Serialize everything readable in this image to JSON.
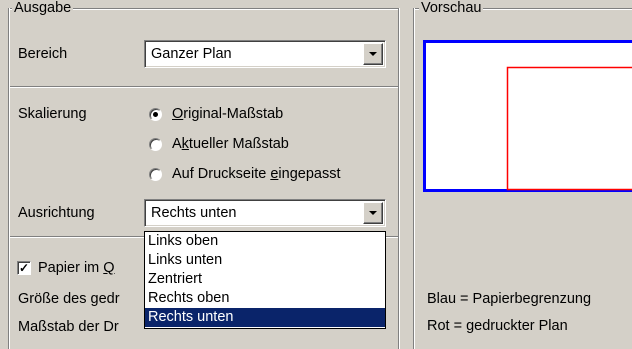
{
  "ausgabe": {
    "group_title": "Ausgabe",
    "bereich_label": "Bereich",
    "bereich_value": "Ganzer Plan",
    "skalierung_label": "Skalierung",
    "skalierung_options": [
      {
        "pre": "",
        "ul": "O",
        "post": "riginal-Maßstab",
        "selected": true
      },
      {
        "pre": "A",
        "ul": "k",
        "post": "tueller Maßstab",
        "selected": false
      },
      {
        "pre": "Auf Druckseite ",
        "ul": "e",
        "post": "ingepasst",
        "selected": false
      }
    ],
    "ausrichtung_label": "Ausrichtung",
    "ausrichtung_value": "Rechts unten",
    "ausrichtung_options": [
      "Links oben",
      "Links unten",
      "Zentriert",
      "Rechts oben",
      "Rechts unten"
    ],
    "ausrichtung_selected_index": 4,
    "papier_checkbox_pre": "Papier im ",
    "papier_checkbox_ul": "Q",
    "papier_checked": true,
    "groesse_label": "Größe des gedr",
    "massstab_label": "Maßstab der Dr"
  },
  "vorschau": {
    "group_title": "Vorschau",
    "legend_blue": "Blau = Papierbegrenzung",
    "legend_red": "Rot = gedruckter Plan",
    "colors": {
      "paper": "#0000ff",
      "plan": "#ff0000"
    }
  }
}
